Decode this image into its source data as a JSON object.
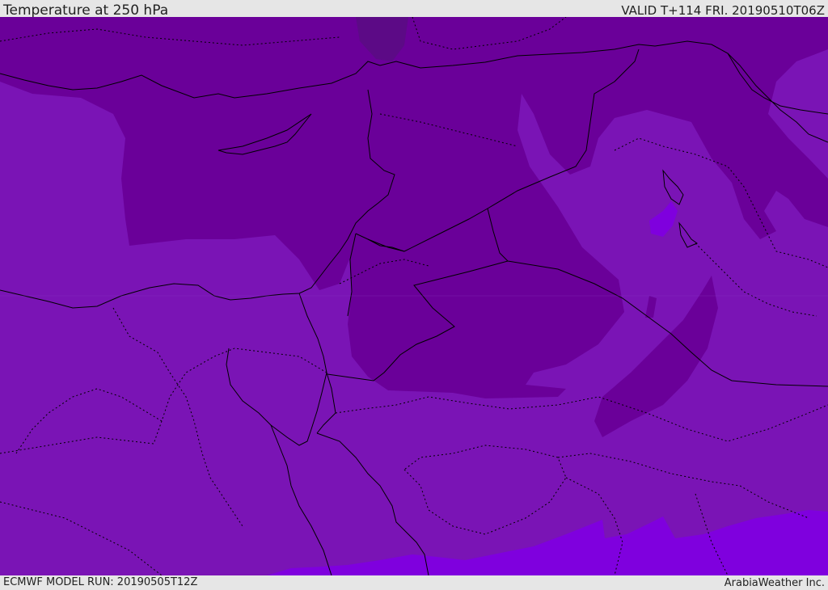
{
  "header": {
    "title": "Temperature at 250 hPa",
    "valid_time": "VALID T+114 FRI. 20190510T06Z"
  },
  "footer": {
    "model_run": "ECMWF MODEL RUN: 20190505T12Z",
    "credit": "ArabiaWeather Inc."
  },
  "colors": {
    "field_base": "#7a14b5",
    "field_cold": "#6a0099",
    "field_colder": "#5c0a86",
    "field_warm": "#7f00de",
    "borders": "#000000"
  }
}
